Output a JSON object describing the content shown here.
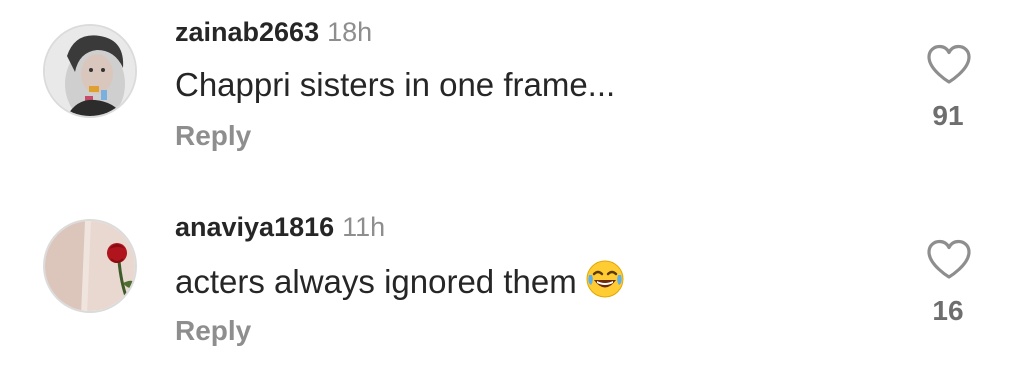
{
  "comments": [
    {
      "username": "zainab2663",
      "time": "18h",
      "text": "Chappri sisters in one frame...",
      "reply_label": "Reply",
      "likes": "91",
      "avatar_icon": "woman-portrait-avatar"
    },
    {
      "username": "anaviya1816",
      "time": "11h",
      "text": "acters always ignored them",
      "emoji": "😂",
      "emoji_icon": "face-with-tears-of-joy-emoji",
      "reply_label": "Reply",
      "likes": "16",
      "avatar_icon": "rose-avatar"
    }
  ],
  "colors": {
    "text_primary": "#262626",
    "text_secondary": "#8e8e8e",
    "like_count": "#6e6e6e",
    "background": "#ffffff"
  }
}
